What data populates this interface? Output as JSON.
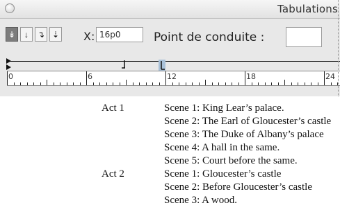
{
  "window": {
    "title": "Tabulations"
  },
  "toolbar": {
    "align_buttons": [
      {
        "glyph": "↡",
        "name": "left-align-tab-button",
        "selected": true
      },
      {
        "glyph": "↓",
        "name": "center-align-tab-button",
        "selected": false
      },
      {
        "glyph": "↴",
        "name": "right-align-tab-button",
        "selected": false
      },
      {
        "glyph": "⇣",
        "name": "decimal-align-tab-button",
        "selected": false
      }
    ],
    "x_label": "X:",
    "x_value": "16p0",
    "leader_label": "Point de conduite :",
    "leader_value": ""
  },
  "ruler": {
    "labels": [
      "0",
      "6",
      "12",
      "18",
      "24"
    ]
  },
  "document": {
    "rows": [
      {
        "act": "Act 1",
        "scene": "Scene 1: King Lear’s palace."
      },
      {
        "act": "",
        "scene": "Scene 2: The Earl of Gloucester’s castle"
      },
      {
        "act": "",
        "scene": "Scene 3: The Duke of Albany’s palace"
      },
      {
        "act": "",
        "scene": "Scene 4: A hall in the same."
      },
      {
        "act": "",
        "scene": "Scene 5: Court before the same."
      },
      {
        "act": "Act 2",
        "scene": "Scene 1: Gloucester’s castle"
      },
      {
        "act": "",
        "scene": "Scene 2: Before Gloucester’s castle"
      },
      {
        "act": "",
        "scene": "Scene 3: A wood."
      }
    ]
  }
}
